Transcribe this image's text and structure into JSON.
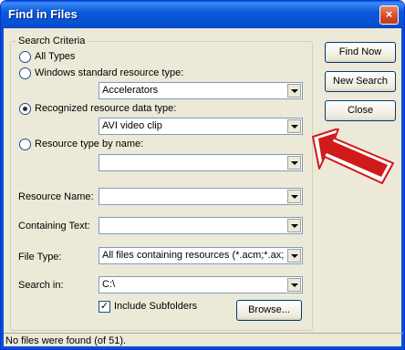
{
  "window": {
    "title": "Find in Files",
    "close_label": "×"
  },
  "group": {
    "legend": "Search Criteria"
  },
  "criteria": {
    "all_types": "All Types",
    "windows_standard": "Windows standard resource type:",
    "windows_standard_value": "Accelerators",
    "recognized": "Recognized resource data type:",
    "recognized_value": "AVI video clip",
    "by_name": "Resource type by name:",
    "by_name_value": "",
    "selected": "recognized"
  },
  "fields": {
    "resource_name_label": "Resource Name:",
    "resource_name_value": "",
    "containing_text_label": "Containing Text:",
    "containing_text_value": "",
    "file_type_label": "File Type:",
    "file_type_value": "All files containing resources (*.acm;*.ax;*.b",
    "search_in_label": "Search in:",
    "search_in_value": "C:\\",
    "include_subfolders_label": "Include Subfolders",
    "include_subfolders_checked": true,
    "browse_label": "Browse..."
  },
  "buttons": {
    "find_now": "Find Now",
    "new_search": "New Search",
    "close": "Close"
  },
  "status": {
    "text": "No files were found (of 51)."
  },
  "colors": {
    "titlebar": "#0651d3",
    "face": "#ece9d8",
    "arrow_fill": "#d11a1a"
  }
}
